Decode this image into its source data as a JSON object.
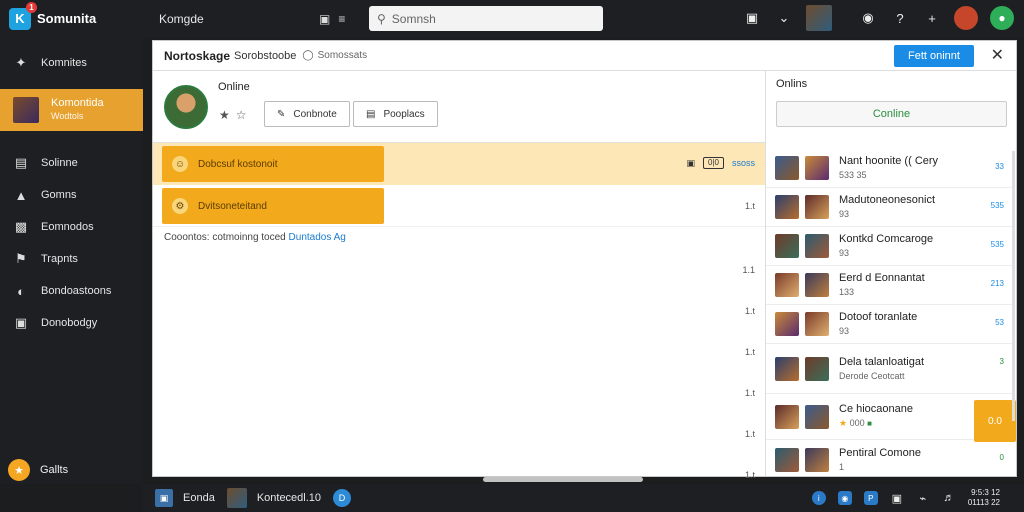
{
  "brand": {
    "name": "Somunita",
    "badge": "1"
  },
  "topbar": {
    "title": "Komgde",
    "icons": [
      "camera-icon",
      "menu-icon"
    ],
    "search_placeholder": "Somnsh",
    "right_icons": [
      "camera-icon",
      "chevron-down-icon",
      "game-thumbnail",
      "bell-icon",
      "help-icon",
      "plus-icon",
      "avatar",
      "friends-icon"
    ]
  },
  "sidebar": {
    "items": [
      {
        "label": "Komnites",
        "icon": "puzzle-icon"
      },
      {
        "label": "Komontida",
        "sub": "Wodtols",
        "icon": "game-thumbnail",
        "active": true
      },
      {
        "label": "Solinne",
        "icon": "list-icon"
      },
      {
        "label": "Gomns",
        "icon": "user-icon"
      },
      {
        "label": "Eomnodos",
        "icon": "chat-icon"
      },
      {
        "label": "Trapnts",
        "icon": "trophy-icon"
      },
      {
        "label": "Bondoastoons",
        "icon": "clock-icon"
      },
      {
        "label": "Donobodgy",
        "icon": "gallery-icon"
      }
    ],
    "footer": {
      "label": "Gallts",
      "icon": "coin-icon"
    }
  },
  "panel": {
    "title": "Nortoskage",
    "subtitle": "Sorobstoobe",
    "globe_label": "Somossats",
    "primary_button": "Fett oninnt",
    "profile": {
      "status": "Online",
      "button_1": "Conbnote",
      "button_2": "Pooplacs"
    },
    "rows": [
      {
        "pill": "Dobcsuf kostonoit",
        "highlight": true,
        "box": "0|0",
        "meta": "ssoss"
      },
      {
        "pill": "Dvitsoneteitand",
        "highlight": false,
        "meta": "1.t"
      }
    ],
    "link_line": {
      "text": "Cooontos: cotmoinng toced",
      "link": "Duntados Ag"
    },
    "meta_column": [
      "1.1",
      "1.t",
      "1.t",
      "1.t",
      "1.t",
      "1.t",
      "1.t"
    ]
  },
  "online": {
    "heading": "Onlins",
    "button": "Conline",
    "friends": [
      {
        "name": "Nant hoonite (( Cery",
        "status": "533 35",
        "badge": "33"
      },
      {
        "name": "Madutoneonesonict",
        "status": "93",
        "badge": "535"
      },
      {
        "name": "Kontkd Comcaroge",
        "status": "93",
        "badge": "535"
      },
      {
        "name": "Eerd d Eonnantat",
        "status": "133",
        "badge": "213"
      },
      {
        "name": "Dotoof toranlate",
        "status": "93",
        "badge": "53"
      },
      {
        "name": "Dela talanloatigat",
        "status": "Derode Ceotcatt",
        "badge": "3"
      },
      {
        "name": "Ce hiocaonane",
        "status": "000",
        "badge": ""
      },
      {
        "name": "Pentiral Comone",
        "status": "1",
        "badge": "0"
      }
    ],
    "tile_label": "0.0"
  },
  "taskbar": {
    "items": [
      {
        "label": "Eonda",
        "icon": "window-icon"
      },
      {
        "label": "Kontecedl.10",
        "icon": "game-thumbnail"
      }
    ],
    "clock_time": "9:5:3 12",
    "clock_date": "01113 22"
  },
  "colors": {
    "accent": "#f2a91c",
    "primary": "#1a8ce6",
    "online_green": "#2a8f3e",
    "chrome": "#1e1f22"
  }
}
